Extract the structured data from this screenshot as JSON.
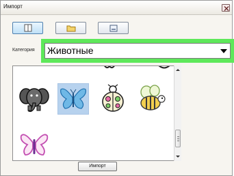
{
  "window": {
    "title": "Импорт",
    "close_icon": "close-icon"
  },
  "toolbar": {
    "buttons": [
      {
        "icon": "frame-view-icon",
        "active": true
      },
      {
        "icon": "folder-icon",
        "active": false
      },
      {
        "icon": "drive-icon",
        "active": false
      }
    ]
  },
  "category": {
    "label": "Категория",
    "selected": "Животные",
    "highlight_color": "#5ee85a"
  },
  "designs": [
    {
      "icon": "elephant-icon",
      "selected": false
    },
    {
      "icon": "butterfly-blue-icon",
      "selected": true
    },
    {
      "icon": "ladybug-icon",
      "selected": false
    },
    {
      "icon": "bee-icon",
      "selected": false
    },
    {
      "icon": "butterfly-pink-icon",
      "selected": false
    }
  ],
  "actions": {
    "import_label": "Импорт"
  }
}
